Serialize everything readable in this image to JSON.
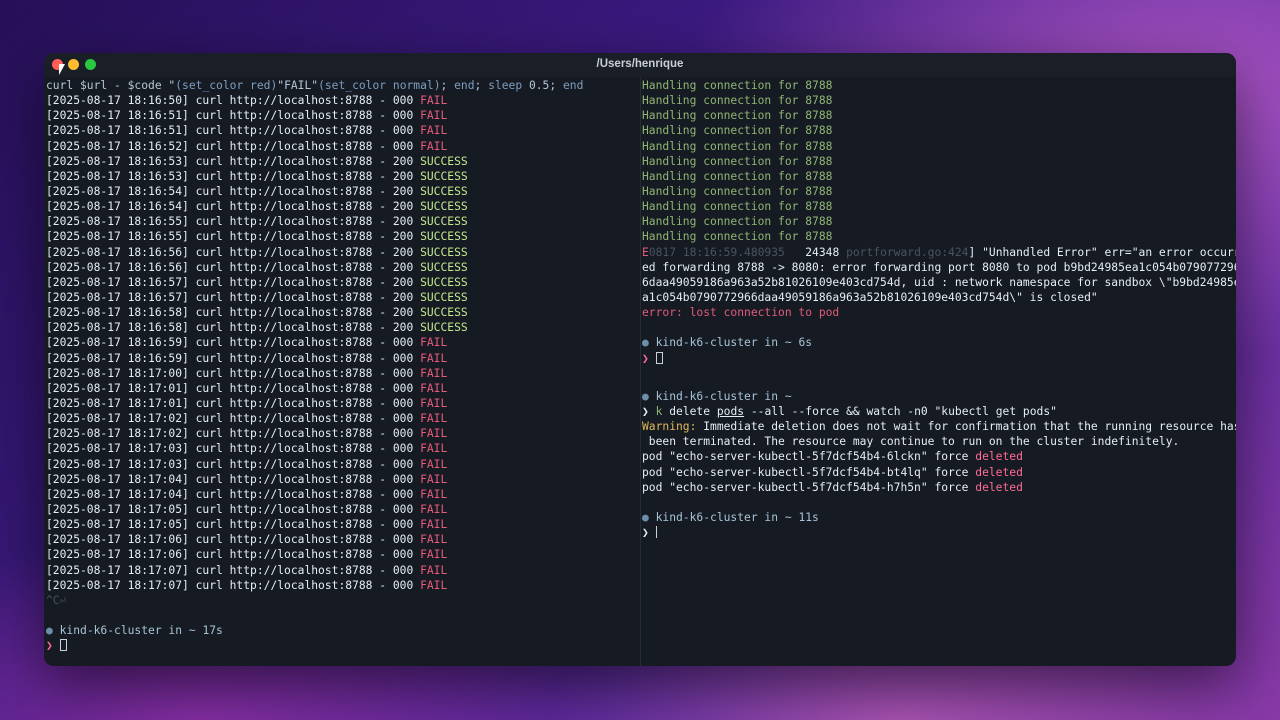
{
  "window": {
    "title": "/Users/henrique"
  },
  "left_pane": {
    "command_tail": {
      "p1": "curl $url - $code \"",
      "p2": "(set_color red)",
      "p3": "\"FAIL\"",
      "p4": "(set_color normal)",
      "p5": "; ",
      "p6": "end",
      "p7": "; ",
      "p8": "sleep",
      "p9": " 0.5",
      "p10": "; ",
      "p11": "end"
    },
    "log_lines": [
      {
        "ts": "[2025-08-17 18:16:50]",
        "cmd": " curl http://localhost:8788 - 000 ",
        "status": "FAIL"
      },
      {
        "ts": "[2025-08-17 18:16:51]",
        "cmd": " curl http://localhost:8788 - 000 ",
        "status": "FAIL"
      },
      {
        "ts": "[2025-08-17 18:16:51]",
        "cmd": " curl http://localhost:8788 - 000 ",
        "status": "FAIL"
      },
      {
        "ts": "[2025-08-17 18:16:52]",
        "cmd": " curl http://localhost:8788 - 000 ",
        "status": "FAIL"
      },
      {
        "ts": "[2025-08-17 18:16:53]",
        "cmd": " curl http://localhost:8788 - 200 ",
        "status": "SUCCESS"
      },
      {
        "ts": "[2025-08-17 18:16:53]",
        "cmd": " curl http://localhost:8788 - 200 ",
        "status": "SUCCESS"
      },
      {
        "ts": "[2025-08-17 18:16:54]",
        "cmd": " curl http://localhost:8788 - 200 ",
        "status": "SUCCESS"
      },
      {
        "ts": "[2025-08-17 18:16:54]",
        "cmd": " curl http://localhost:8788 - 200 ",
        "status": "SUCCESS"
      },
      {
        "ts": "[2025-08-17 18:16:55]",
        "cmd": " curl http://localhost:8788 - 200 ",
        "status": "SUCCESS"
      },
      {
        "ts": "[2025-08-17 18:16:55]",
        "cmd": " curl http://localhost:8788 - 200 ",
        "status": "SUCCESS"
      },
      {
        "ts": "[2025-08-17 18:16:56]",
        "cmd": " curl http://localhost:8788 - 200 ",
        "status": "SUCCESS"
      },
      {
        "ts": "[2025-08-17 18:16:56]",
        "cmd": " curl http://localhost:8788 - 200 ",
        "status": "SUCCESS"
      },
      {
        "ts": "[2025-08-17 18:16:57]",
        "cmd": " curl http://localhost:8788 - 200 ",
        "status": "SUCCESS"
      },
      {
        "ts": "[2025-08-17 18:16:57]",
        "cmd": " curl http://localhost:8788 - 200 ",
        "status": "SUCCESS"
      },
      {
        "ts": "[2025-08-17 18:16:58]",
        "cmd": " curl http://localhost:8788 - 200 ",
        "status": "SUCCESS"
      },
      {
        "ts": "[2025-08-17 18:16:58]",
        "cmd": " curl http://localhost:8788 - 200 ",
        "status": "SUCCESS"
      },
      {
        "ts": "[2025-08-17 18:16:59]",
        "cmd": " curl http://localhost:8788 - 000 ",
        "status": "FAIL"
      },
      {
        "ts": "[2025-08-17 18:16:59]",
        "cmd": " curl http://localhost:8788 - 000 ",
        "status": "FAIL"
      },
      {
        "ts": "[2025-08-17 18:17:00]",
        "cmd": " curl http://localhost:8788 - 000 ",
        "status": "FAIL"
      },
      {
        "ts": "[2025-08-17 18:17:01]",
        "cmd": " curl http://localhost:8788 - 000 ",
        "status": "FAIL"
      },
      {
        "ts": "[2025-08-17 18:17:01]",
        "cmd": " curl http://localhost:8788 - 000 ",
        "status": "FAIL"
      },
      {
        "ts": "[2025-08-17 18:17:02]",
        "cmd": " curl http://localhost:8788 - 000 ",
        "status": "FAIL"
      },
      {
        "ts": "[2025-08-17 18:17:02]",
        "cmd": " curl http://localhost:8788 - 000 ",
        "status": "FAIL"
      },
      {
        "ts": "[2025-08-17 18:17:03]",
        "cmd": " curl http://localhost:8788 - 000 ",
        "status": "FAIL"
      },
      {
        "ts": "[2025-08-17 18:17:03]",
        "cmd": " curl http://localhost:8788 - 000 ",
        "status": "FAIL"
      },
      {
        "ts": "[2025-08-17 18:17:04]",
        "cmd": " curl http://localhost:8788 - 000 ",
        "status": "FAIL"
      },
      {
        "ts": "[2025-08-17 18:17:04]",
        "cmd": " curl http://localhost:8788 - 000 ",
        "status": "FAIL"
      },
      {
        "ts": "[2025-08-17 18:17:05]",
        "cmd": " curl http://localhost:8788 - 000 ",
        "status": "FAIL"
      },
      {
        "ts": "[2025-08-17 18:17:05]",
        "cmd": " curl http://localhost:8788 - 000 ",
        "status": "FAIL"
      },
      {
        "ts": "[2025-08-17 18:17:06]",
        "cmd": " curl http://localhost:8788 - 000 ",
        "status": "FAIL"
      },
      {
        "ts": "[2025-08-17 18:17:06]",
        "cmd": " curl http://localhost:8788 - 000 ",
        "status": "FAIL"
      },
      {
        "ts": "[2025-08-17 18:17:07]",
        "cmd": " curl http://localhost:8788 - 000 ",
        "status": "FAIL"
      },
      {
        "ts": "[2025-08-17 18:17:07]",
        "cmd": " curl http://localhost:8788 - 000 ",
        "status": "FAIL"
      }
    ],
    "interrupt": "^C⏎",
    "prompt": {
      "dot": "●",
      "text": " kind-k6-cluster in ~ 17s",
      "chevron": "❯ "
    }
  },
  "right_pane": {
    "handling": [
      "Handling connection for 8788",
      "Handling connection for 8788",
      "Handling connection for 8788",
      "Handling connection for 8788",
      "Handling connection for 8788",
      "Handling connection for 8788",
      "Handling connection for 8788",
      "Handling connection for 8788",
      "Handling connection for 8788",
      "Handling connection for 8788",
      "Handling connection for 8788"
    ],
    "error_block": {
      "e_prefix": "E",
      "e_dim": "0817 18:16:59.480935",
      "e_pid": "   24348 ",
      "e_file": "portforward.go:424",
      "e_rest": "] \"Unhandled Error\" err=\"an error occurr",
      "line2": "ed forwarding 8788 -> 8080: error forwarding port 8080 to pod b9bd24985ea1c054b079077296",
      "line3": "6daa49059186a963a52b81026109e403cd754d, uid : network namespace for sandbox \\\"b9bd24985e",
      "line4": "a1c054b0790772966daa49059186a963a52b81026109e403cd754d\\\" is closed\"",
      "lost": "error: lost connection to pod"
    },
    "prompt1": {
      "dot": "●",
      "text": " kind-k6-cluster in ~ 6s",
      "chevron": "❯ "
    },
    "prompt2": {
      "dot": "●",
      "text": " kind-k6-cluster in ~",
      "chevron": "❯ ",
      "cmd_k": "k",
      "cmd_delete": " delete ",
      "cmd_pods": "pods",
      "cmd_rest": " --all --force && watch -n0 \"kubectl get pods\""
    },
    "warning": {
      "label": "Warning:",
      "text1": " Immediate deletion does not wait for confirmation that the running resource has",
      "text2": " been terminated. The resource may continue to run on the cluster indefinitely."
    },
    "pods": [
      {
        "text": "pod \"echo-server-kubectl-5f7dcf54b4-6lckn\" force ",
        "status": "deleted"
      },
      {
        "text": "pod \"echo-server-kubectl-5f7dcf54b4-bt4lq\" force ",
        "status": "deleted"
      },
      {
        "text": "pod \"echo-server-kubectl-5f7dcf54b4-h7h5n\" force ",
        "status": "deleted"
      }
    ],
    "prompt3": {
      "dot": "●",
      "text": " kind-k6-cluster in ~ 11s",
      "chevron": "❯ "
    }
  }
}
